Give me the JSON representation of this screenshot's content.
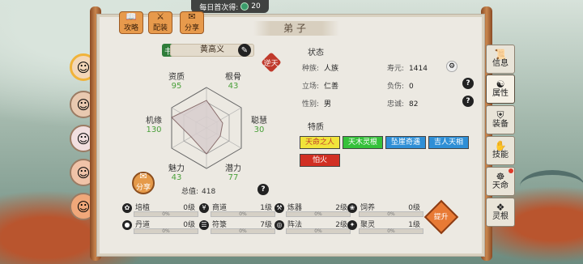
{
  "top": {
    "daily_first_label": "每日首次得:",
    "daily_first_value": "20",
    "coin_icon": "jade-coin-icon"
  },
  "top_tabs": [
    {
      "label": "攻略",
      "icon": "book-icon"
    },
    {
      "label": "配装",
      "icon": "equipment-icon"
    },
    {
      "label": "分享",
      "icon": "share-icon"
    }
  ],
  "title": "弟子",
  "character": {
    "name": "黄高义"
  },
  "radar": {
    "stats": [
      {
        "label": "资质",
        "value": "95"
      },
      {
        "label": "根骨",
        "value": "43"
      },
      {
        "label": "聪慧",
        "value": "30"
      },
      {
        "label": "潜力",
        "value": "77"
      },
      {
        "label": "魅力",
        "value": "43"
      },
      {
        "label": "机缘",
        "value": "130"
      }
    ],
    "total_label": "总值:",
    "total_value": "418",
    "share_label": "分享"
  },
  "status": {
    "title": "状态",
    "race_label": "种族:",
    "race": "人族",
    "lifespan_label": "寿元:",
    "lifespan": "1414",
    "stance_label": "立场:",
    "stance": "仁善",
    "burden_label": "负伤:",
    "burden": "0",
    "gender_label": "性别:",
    "gender": "男",
    "loyalty_label": "忠诚:",
    "loyalty": "82",
    "traits_title": "特质",
    "traits": [
      {
        "label": "天命之人",
        "color": "#f1e43a",
        "text": "#c0392b"
      },
      {
        "label": "天木灵根",
        "color": "#35c13a",
        "text": "#ffffff"
      },
      {
        "label": "坠崖奇遇",
        "color": "#2f8fd6",
        "text": "#ffffff"
      },
      {
        "label": "吉人天相",
        "color": "#2f8fd6",
        "text": "#ffffff"
      },
      {
        "label": "怕火",
        "color": "#d12f23",
        "text": "#ffffff"
      }
    ]
  },
  "skills": [
    {
      "name": "培植",
      "level": "0级",
      "pct": "0%",
      "icon": "plant-icon"
    },
    {
      "name": "商道",
      "level": "1级",
      "pct": "0%",
      "icon": "coin-icon"
    },
    {
      "name": "炼器",
      "level": "2级",
      "pct": "0%",
      "icon": "forge-icon"
    },
    {
      "name": "饲养",
      "level": "0级",
      "pct": "0%",
      "icon": "pet-icon"
    },
    {
      "name": "丹道",
      "level": "0级",
      "pct": "0%",
      "icon": "pill-icon"
    },
    {
      "name": "符箓",
      "level": "7级",
      "pct": "0%",
      "icon": "talisman-icon"
    },
    {
      "name": "阵法",
      "level": "2级",
      "pct": "0%",
      "icon": "formation-icon"
    },
    {
      "name": "聚灵",
      "level": "1级",
      "pct": "0%",
      "icon": "spirit-icon"
    }
  ],
  "upgrade_label": "提升",
  "side_tabs": [
    {
      "label": "信息",
      "icon": "info-icon"
    },
    {
      "label": "属性",
      "icon": "attribute-icon"
    },
    {
      "label": "装备",
      "icon": "armor-icon"
    },
    {
      "label": "技能",
      "icon": "skill-icon"
    },
    {
      "label": "天命",
      "icon": "destiny-icon"
    },
    {
      "label": "灵根",
      "icon": "spirit-root-icon"
    }
  ]
}
